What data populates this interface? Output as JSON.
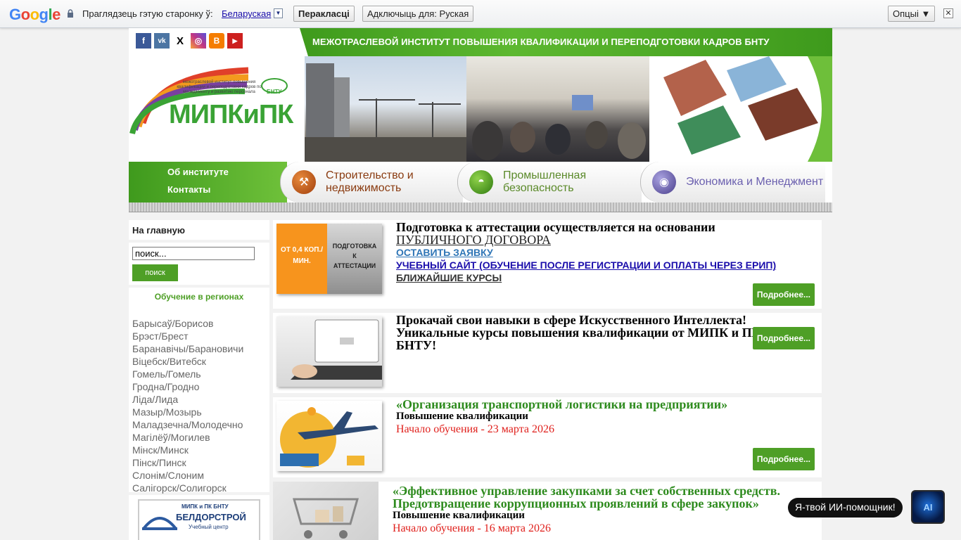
{
  "translate_bar": {
    "prompt": "Праглядзець гэтую старонку ў:",
    "language": "Беларуская",
    "dropdown_glyph": "▼",
    "translate_label": "Перакласці",
    "disable_label": "Адключыць для: Руская",
    "options_label": "Опцыі ▼",
    "close_glyph": "✕"
  },
  "header": {
    "banner_title": "МЕЖОТРАСЛЕВОЙ ИНСТИТУТ ПОВЫШЕНИЯ КВАЛИФИКАЦИИ И ПЕРЕПОДГОТОВКИ КАДРОВ БНТУ",
    "logo_caption": "межотраслевой институт повышения квалификации и переподготовки кадров по менеджменту и развитию персонала",
    "logo_badge": "БНТУ",
    "logo_name": "МИПКиПК",
    "social": [
      {
        "name": "facebook",
        "glyph": "f",
        "color": "#3b5998"
      },
      {
        "name": "vk",
        "glyph": "vk",
        "color": "#4c75a3"
      },
      {
        "name": "x",
        "glyph": "X",
        "color": "#ffffff"
      },
      {
        "name": "instagram",
        "glyph": "◎",
        "color": "#c13584"
      },
      {
        "name": "blogger",
        "glyph": "B",
        "color": "#f57d00"
      },
      {
        "name": "youtube",
        "glyph": "▶",
        "color": "#cd201f"
      }
    ]
  },
  "left_menu": {
    "about": "Об институте",
    "contacts": "Контакты"
  },
  "tabs": [
    {
      "label": "Строительство и недвижимость",
      "color": "#8a3b10",
      "icon": "crane-icon"
    },
    {
      "label": "Промышленная безопасность",
      "color": "#5b8a2a",
      "icon": "helmet-icon"
    },
    {
      "label": "Экономика и Менеджмент",
      "color": "#6a5fae",
      "icon": "coins-icon"
    }
  ],
  "sidebar": {
    "home": "На главную",
    "search_value": "поиск...",
    "search_button": "поиск",
    "regions_title": "Обучение в регионах",
    "regions": [
      "Барысаў/Борисов",
      "Брэст/Брест",
      "Баранавічы/Барановичи",
      "Віцебск/Витебск",
      "Гомель/Гомель",
      "Гродна/Гродно",
      "Ліда/Лида",
      "Мазыр/Мозырь",
      "Маладзечна/Молодечно",
      "Магілёў/Могилев",
      "Мінск/Минск",
      "Пінск/Пинск",
      "Слонім/Слоним",
      "Салігорск/Солигорск"
    ],
    "partner_line1": "МИПК и ПК БНТУ",
    "partner_line2": "БЕЛДОРСТРОЙ",
    "partner_line3": "Учебный центр"
  },
  "cards": [
    {
      "title": "Подготовка к аттестации осуществляется на основании",
      "title2": "ПУБЛИЧНОГО ДОГОВОРА",
      "link1": "ОСТАВИТЬ ЗАЯВКУ",
      "link2": "УЧЕБНЫЙ САЙТ (ОБУЧЕНИЕ ПОСЛЕ РЕГИСТРАЦИИ И ОПЛАТЫ ЧЕРЕЗ ЕРИП)",
      "link3": "БЛИЖАЙШИЕ КУРСЫ",
      "thumb_left": "ОТ 0,4 КОП./МИН.",
      "thumb_right": "ПОДГОТОВКА К АТТЕСТАЦИИ",
      "more": "Подробнее..."
    },
    {
      "title": "Прокачай свои навыки в сфере Искусственного Интеллекта! Уникальные курсы повышения квалификации от МИПК и ПК БНТУ!",
      "more": "Подробнее..."
    },
    {
      "title": "«Организация транспортной логистики на предприятии»",
      "subtitle": "Повышение квалификации",
      "date": "Начало обучения - 23 марта 2026",
      "more": "Подробнее..."
    },
    {
      "title": "«Эффективное управление закупками за счет собственных средств. Предотвращение коррупционных проявлений в сфере закупок»",
      "subtitle": "Повышение квалификации",
      "date": "Начало обучения - 16 марта 2026"
    }
  ],
  "ai": {
    "bubble": "Я-твой ИИ-помощник!",
    "button": "AI"
  }
}
